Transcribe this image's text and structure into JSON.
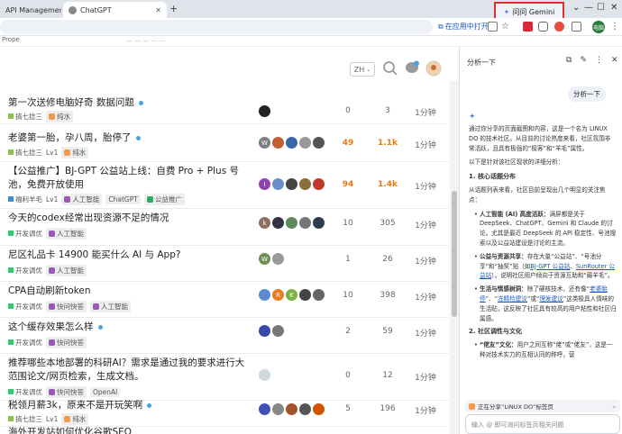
{
  "browser": {
    "tabs": [
      {
        "label": "API Management |",
        "close": "✕"
      },
      {
        "label": "ChatGPT",
        "close": "✕"
      }
    ],
    "new_tab": "+",
    "gemini_button": "问问 Gemini",
    "window_controls": [
      "⌄",
      "—",
      "☐",
      "✕"
    ],
    "open_in_app": "在应用中打开",
    "profile_initials": "电脑",
    "bookmarks_text": "Prope"
  },
  "forum": {
    "language": "ZH",
    "topics": [
      {
        "title": "第一次送修电脑好奇 数据问题",
        "category": "搞七捻三",
        "category_color": "#8bc34a",
        "level": "",
        "tags": [
          {
            "label": "纯水",
            "icon_color": "#f2994a"
          }
        ],
        "avatars": [
          {
            "letter": "",
            "color": "#222"
          }
        ],
        "replies": "0",
        "views": "3",
        "activity": "1分钟",
        "hot": false
      },
      {
        "title": "老婆第一胎，孕八周，胎停了",
        "category": "搞七捻三",
        "category_color": "#8bc34a",
        "level": "Lv1",
        "tags": [
          {
            "label": "纯水",
            "icon_color": "#f2994a"
          }
        ],
        "avatars": [
          {
            "letter": "W",
            "color": "#7d7d7d"
          },
          {
            "letter": "",
            "color": "#c06030"
          },
          {
            "letter": "",
            "color": "#3a66a8"
          },
          {
            "letter": "",
            "color": "#999"
          },
          {
            "letter": "",
            "color": "#555"
          }
        ],
        "replies": "49",
        "views": "1.1k",
        "activity": "1分钟",
        "hot": true
      },
      {
        "title": "【公益推广】BJ-GPT 公益站上线：自费 Pro + Plus 号池，免费开放使用",
        "category": "福利羊毛",
        "category_color": "#3a8fd8",
        "level": "Lv1",
        "tags": [
          {
            "label": "人工智能",
            "icon_color": "#9b59b6"
          },
          {
            "label": "ChatGPT",
            "icon_color": ""
          },
          {
            "label": "公益推广",
            "icon_color": "#27ae60"
          }
        ],
        "avatars": [
          {
            "letter": "I",
            "color": "#8e44ad"
          },
          {
            "letter": "",
            "color": "#6a8fc7"
          },
          {
            "letter": "",
            "color": "#444"
          },
          {
            "letter": "",
            "color": "#8a6d3b"
          },
          {
            "letter": "",
            "color": "#c0392b"
          }
        ],
        "replies": "94",
        "views": "1.4k",
        "activity": "1分钟",
        "hot": true
      },
      {
        "title": "今天的codex经常出现资源不足的情况",
        "category": "开发调优",
        "category_color": "#2ecc71",
        "level": "",
        "tags": [
          {
            "label": "人工智能",
            "icon_color": "#9b59b6"
          }
        ],
        "avatars": [
          {
            "letter": "k",
            "color": "#8d6e63"
          },
          {
            "letter": "",
            "color": "#334"
          },
          {
            "letter": "",
            "color": "#5c8a5c"
          },
          {
            "letter": "",
            "color": "#777"
          },
          {
            "letter": "",
            "color": "#2c3e50"
          }
        ],
        "replies": "10",
        "views": "305",
        "activity": "1分钟",
        "hot": false
      },
      {
        "title": "尼区礼品卡 14900 能买什么 AI 与 App?",
        "category": "开发调优",
        "category_color": "#2ecc71",
        "level": "",
        "tags": [
          {
            "label": "人工智能",
            "icon_color": "#9b59b6"
          }
        ],
        "avatars": [
          {
            "letter": "W",
            "color": "#6d8f56"
          },
          {
            "letter": "",
            "color": "#999"
          }
        ],
        "replies": "1",
        "views": "26",
        "activity": "1分钟",
        "hot": false
      },
      {
        "title": "CPA自动刷新token",
        "category": "开发调优",
        "category_color": "#2ecc71",
        "level": "",
        "tags": [
          {
            "label": "快问快答",
            "icon_color": "#9b59b6"
          },
          {
            "label": "人工智能",
            "icon_color": "#9b59b6"
          }
        ],
        "avatars": [
          {
            "letter": "",
            "color": "#5b8bd0"
          },
          {
            "letter": "R",
            "color": "#e67e22"
          },
          {
            "letter": "K",
            "color": "#7cb342"
          },
          {
            "letter": "",
            "color": "#444"
          },
          {
            "letter": "",
            "color": "#666"
          }
        ],
        "replies": "10",
        "views": "398",
        "activity": "1分钟",
        "hot": false
      },
      {
        "title": "这个缓存效果怎么样",
        "category": "开发调优",
        "category_color": "#2ecc71",
        "level": "",
        "tags": [
          {
            "label": "快问快答",
            "icon_color": "#9b59b6"
          }
        ],
        "avatars": [
          {
            "letter": "",
            "color": "#3949ab"
          },
          {
            "letter": "",
            "color": "#777"
          }
        ],
        "replies": "2",
        "views": "59",
        "activity": "1分钟",
        "hot": false
      },
      {
        "title": "推荐哪些本地部署的科研AI？需求是通过我的要求进行大范围论文/网页检索，生成文档。",
        "category": "开发调优",
        "category_color": "#2ecc71",
        "level": "",
        "tags": [
          {
            "label": "快问快答",
            "icon_color": "#9b59b6"
          },
          {
            "label": "OpenAI",
            "icon_color": ""
          }
        ],
        "avatars": [
          {
            "letter": "",
            "color": "#cfd8dc"
          }
        ],
        "replies": "0",
        "views": "12",
        "activity": "1分钟",
        "hot": false
      },
      {
        "title": "税领月薪3k，原来不是开玩笑啊",
        "category": "搞七捻三",
        "category_color": "#8bc34a",
        "level": "Lv1",
        "tags": [
          {
            "label": "纯水",
            "icon_color": "#f2994a"
          }
        ],
        "avatars": [
          {
            "letter": "",
            "color": "#3f51b5"
          },
          {
            "letter": "",
            "color": "#888"
          },
          {
            "letter": "",
            "color": "#a0522d"
          },
          {
            "letter": "",
            "color": "#555"
          },
          {
            "letter": "",
            "color": "#d35400"
          }
        ],
        "replies": "5",
        "views": "196",
        "activity": "1分钟",
        "hot": false
      },
      {
        "title": "海外开发站如何优化谷歌SEO",
        "category": "",
        "category_color": "#2ecc71",
        "level": "",
        "tags": [],
        "avatars": [],
        "replies": "",
        "views": "",
        "activity": "",
        "hot": false
      }
    ]
  },
  "panel": {
    "title": "分析一下",
    "user_message": "分析一下",
    "intro": "通过你分享的页面截图和内容，这是一个名为 LINUX DO 的技术社区。从目前的讨论热度来看，社区氛围非常活跃，且具有极强的“极客”和“羊毛”属性。",
    "lead": "以下是针对该社区现状的详细分析：",
    "s1_title": "1. 核心话题分布",
    "s1_desc": "从话题列表来看，社区目前呈现出几个明显的关注焦点：",
    "b1_label": "人工智能 (AI) 高度活跃：",
    "b1_text": "满屏都是关于 DeepSeek、ChatGPT、Gemini 和 Claude 的讨论。尤其是最近 DeepSeek 的 API 稳定性、号池搜索以及公益站建设是讨论的主流。",
    "b2_label": "公益与资源共享：",
    "b2_pre": "存在大量“公益站”、“号池分享”和“抽奖”贴（如",
    "b2_link1": "BJ-GPT 公益站",
    "b2_mid": "、",
    "b2_link2": "SunRouter 公益站",
    "b2_post": "）。说明社区用户倾向于资源互助和“薅羊毛”。",
    "b3_label": "生活与情感树洞：",
    "b3_pre": "除了硬核技术，还有像“",
    "b3_link1": "老婆胎停",
    "b3_mid1": "”、“",
    "b3_link2": "冻精检建议",
    "b3_mid2": "”或“",
    "b3_link3": "理发建议",
    "b3_post": "”这类极具人情味的生活贴，这反映了社区具有较高的用户粘性和社区归属感。",
    "s2_title": "2. 社区调性与文化",
    "s2_b1_label": "“佬友”文化：",
    "s2_b1_text": "用户之间互称“佬”或“佬友”，这是一种对技术实力的互相认同的称呼，营",
    "share_label": "正在分享“LINUX DO”标签页",
    "share_chevron": "⌄",
    "input_placeholder": "输入 @ 即可询问标签页相关问题"
  }
}
